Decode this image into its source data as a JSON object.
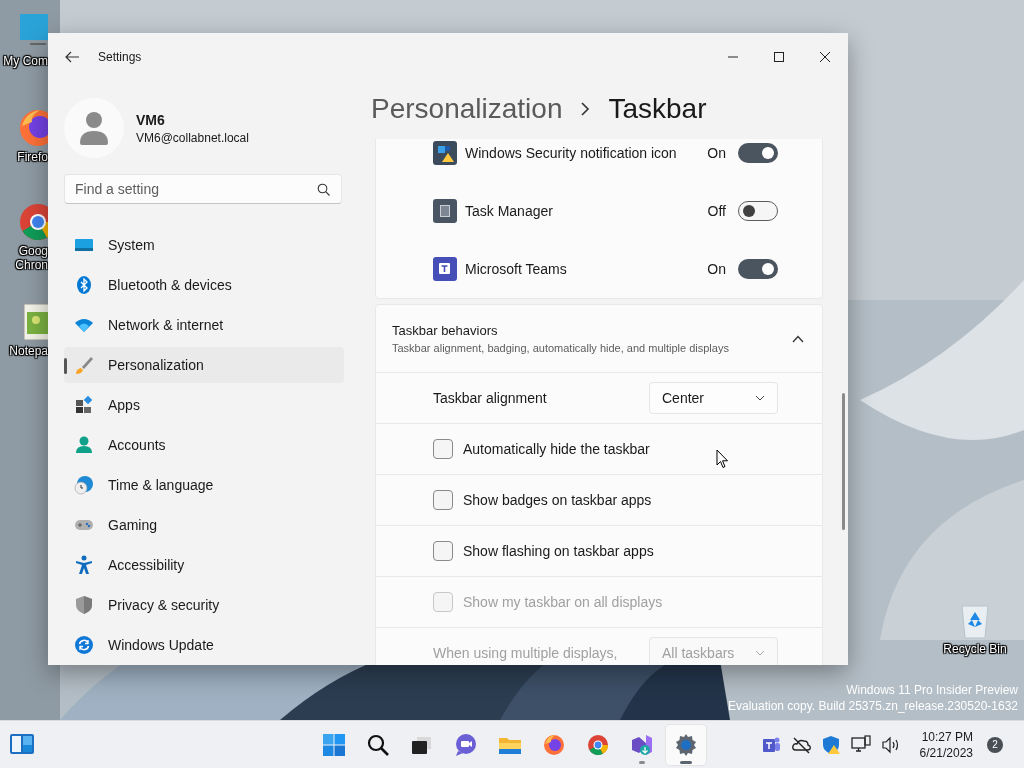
{
  "desktop": {
    "icons": [
      {
        "label": "My Com"
      },
      {
        "label": "Firefo"
      },
      {
        "label": "Goog Chron"
      },
      {
        "label": "Notepa"
      },
      {
        "label": "Recycle Bin"
      }
    ],
    "edition": [
      "Windows 11 Pro Insider Preview",
      "Evaluation copy. Build 25375.zn_release.230520-1632"
    ]
  },
  "window": {
    "title": "Settings",
    "account": {
      "name": "VM6",
      "email": "VM6@collabnet.local"
    },
    "search": {
      "placeholder": "Find a setting"
    },
    "sidebar": {
      "items": [
        {
          "label": "System",
          "selected": false
        },
        {
          "label": "Bluetooth & devices",
          "selected": false
        },
        {
          "label": "Network & internet",
          "selected": false
        },
        {
          "label": "Personalization",
          "selected": true
        },
        {
          "label": "Apps",
          "selected": false
        },
        {
          "label": "Accounts",
          "selected": false
        },
        {
          "label": "Time & language",
          "selected": false
        },
        {
          "label": "Gaming",
          "selected": false
        },
        {
          "label": "Accessibility",
          "selected": false
        },
        {
          "label": "Privacy & security",
          "selected": false
        },
        {
          "label": "Windows Update",
          "selected": false
        }
      ]
    },
    "breadcrumb": [
      "Personalization",
      "Taskbar"
    ],
    "other_icons": [
      {
        "label": "Windows Security notification icon",
        "state": "On",
        "on": true
      },
      {
        "label": "Task Manager",
        "state": "Off",
        "on": false
      },
      {
        "label": "Microsoft Teams",
        "state": "On",
        "on": true
      }
    ],
    "behaviors": {
      "title": "Taskbar behaviors",
      "subtitle": "Taskbar alignment, badging, automatically hide, and multiple displays",
      "expanded": true,
      "rows": [
        {
          "kind": "dropdown",
          "label": "Taskbar alignment",
          "value": "Center",
          "disabled": false
        },
        {
          "kind": "checkbox",
          "label": "Automatically hide the taskbar",
          "checked": false,
          "disabled": false
        },
        {
          "kind": "checkbox",
          "label": "Show badges on taskbar apps",
          "checked": false,
          "disabled": false
        },
        {
          "kind": "checkbox",
          "label": "Show flashing on taskbar apps",
          "checked": false,
          "disabled": false
        },
        {
          "kind": "checkbox",
          "label": "Show my taskbar on all displays",
          "checked": false,
          "disabled": true
        },
        {
          "kind": "dropdown",
          "label": "When using multiple displays,",
          "value": "All taskbars",
          "disabled": true
        }
      ]
    }
  },
  "taskbar": {
    "apps": [
      {
        "running": false,
        "active": false
      },
      {
        "running": false,
        "active": false
      },
      {
        "running": false,
        "active": false
      },
      {
        "running": false,
        "active": false
      },
      {
        "running": false,
        "active": false
      },
      {
        "running": false,
        "active": false
      },
      {
        "running": false,
        "active": false
      },
      {
        "running": true,
        "active": false
      },
      {
        "running": true,
        "active": true
      }
    ],
    "time": "10:27 PM",
    "date": "6/21/2023",
    "notifications": "2"
  }
}
